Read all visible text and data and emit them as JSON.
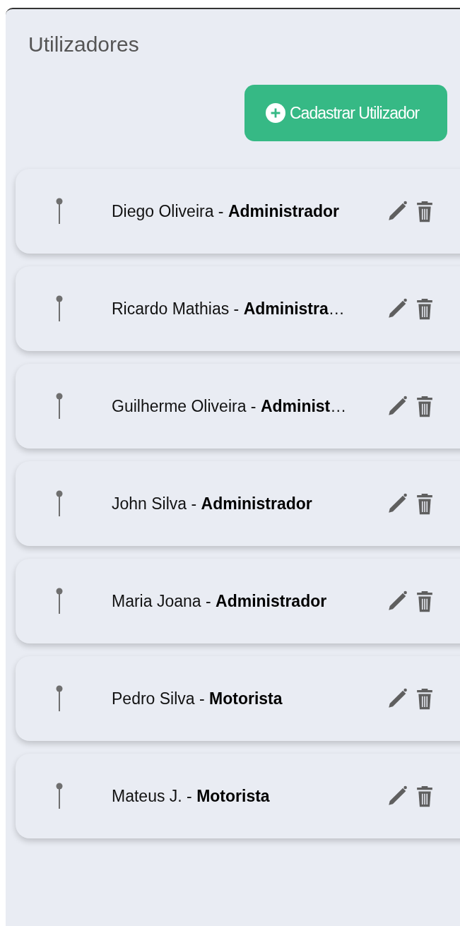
{
  "title": "Utilizadores",
  "add_button": {
    "label": "Cadastrar Utilizador"
  },
  "users": [
    {
      "label": "Diego Oliveira - **Administrador**"
    },
    {
      "label": "Ricardo Mathias - **Administra**…"
    },
    {
      "label": "Guilherme Oliveira - **Administ**…"
    },
    {
      "label": "John Silva - **Administrador**"
    },
    {
      "label": "Maria Joana - **Administrador**"
    },
    {
      "label": "Pedro Silva - **Motorista**"
    },
    {
      "label": "Mateus J. - **Motorista**"
    }
  ]
}
